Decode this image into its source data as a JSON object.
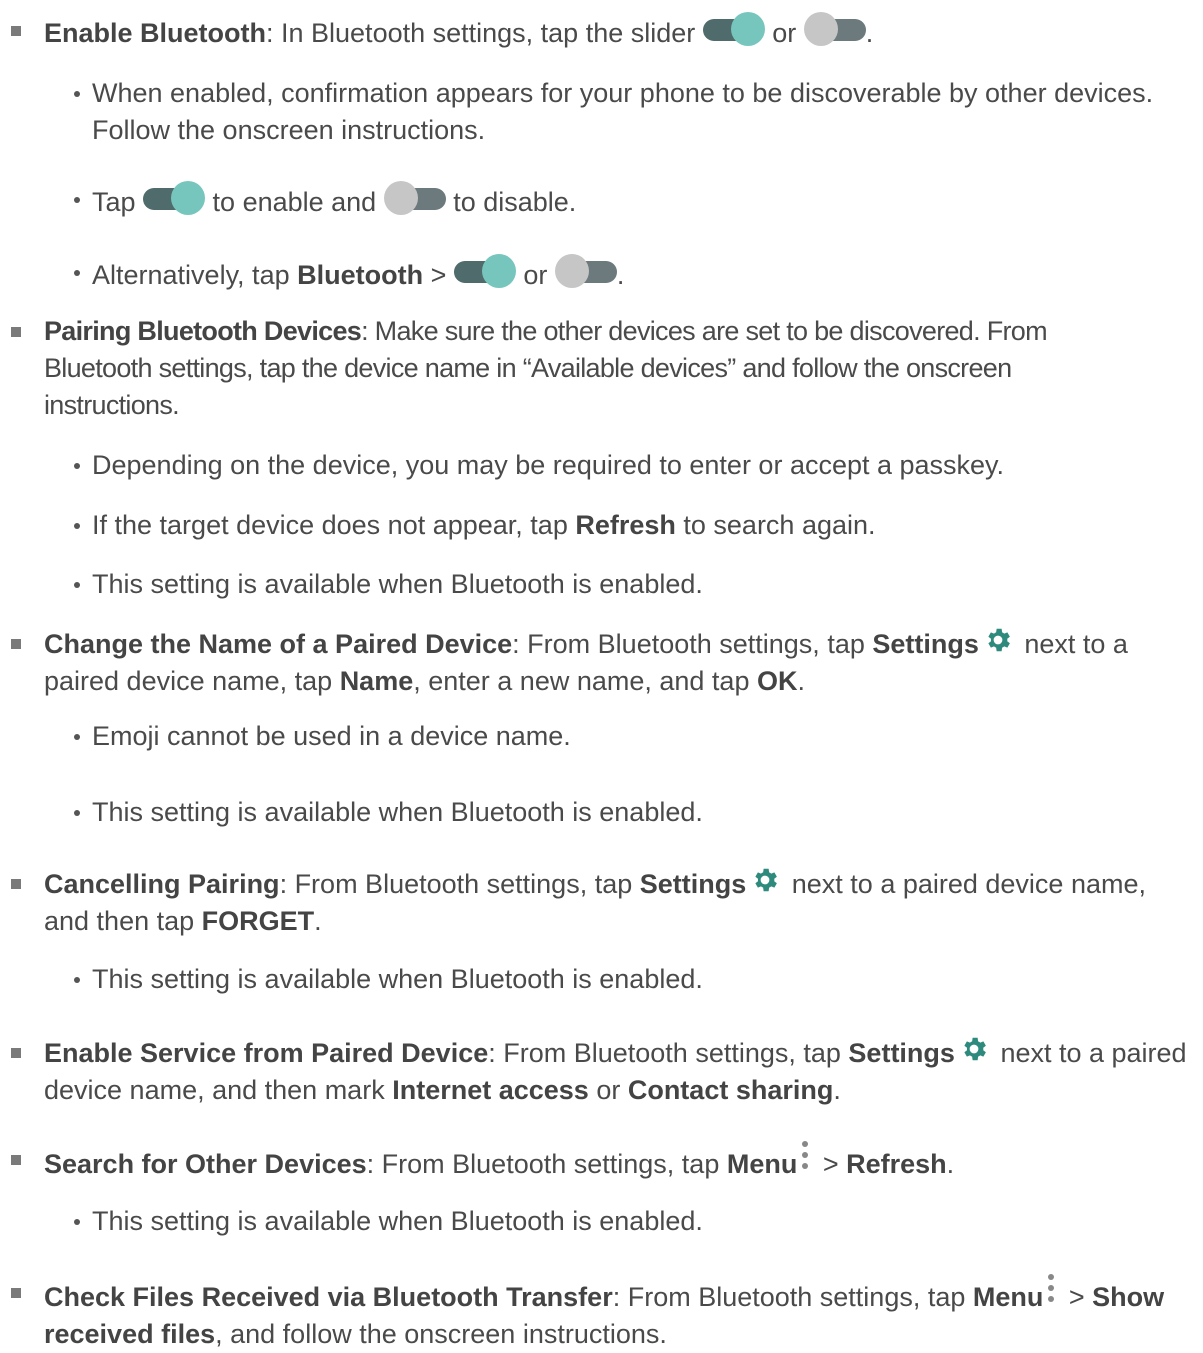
{
  "items": {
    "enable": {
      "title": "Enable Bluetooth",
      "t1": ": In Bluetooth settings, tap the slider ",
      "t2": " or ",
      "t3": ".",
      "sub1": "When enabled, confirmation appears for your phone to be discoverable by other devices. Follow the onscreen instructions.",
      "sub2a": "Tap ",
      "sub2b": " to enable and ",
      "sub2c": " to disable.",
      "sub3a": "Alternatively, tap ",
      "sub3b": "Bluetooth",
      "sub3c": " > ",
      "sub3d": " or ",
      "sub3e": "."
    },
    "pairing": {
      "title": "Pairing Bluetooth Devices",
      "text": ": Make sure the other devices are set to be discovered. From Bluetooth settings, tap the device name in “Available devices” and follow the onscreen instructions.",
      "sub1": "Depending on the device, you may be required to enter or accept a passkey.",
      "sub2a": "If the target device does not appear, tap ",
      "sub2b": "Refresh",
      "sub2c": " to search again.",
      "sub3": "This setting is available when Bluetooth is enabled."
    },
    "rename": {
      "title": "Change the Name of a Paired Device",
      "t1": ": From Bluetooth settings, tap ",
      "t2": "Settings",
      "t3": " next to a paired device name, tap ",
      "t4": "Name",
      "t5": ", enter a new name, and tap ",
      "t6": "OK",
      "t7": ".",
      "sub1": "Emoji cannot be used in a device name.",
      "sub2": "This setting is available when Bluetooth is enabled."
    },
    "cancel": {
      "title": "Cancelling Pairing",
      "t1": ": From Bluetooth settings, tap ",
      "t2": "Settings",
      "t3": " next to a paired device name, and then tap ",
      "t4": "FORGET",
      "t5": ".",
      "sub1": "This setting is available when Bluetooth is enabled."
    },
    "service": {
      "title": "Enable Service from Paired Device",
      "t1": ": From Bluetooth settings, tap ",
      "t2": "Settings",
      "t3": " next to a paired device name, and then mark ",
      "t4": "Internet access",
      "t5": " or ",
      "t6": "Contact sharing",
      "t7": "."
    },
    "search": {
      "title": "Search for Other Devices",
      "t1": ": From Bluetooth settings, tap ",
      "t2": "Menu",
      "t3": " > ",
      "t4": "Refresh",
      "t5": ".",
      "sub1": "This setting is available when Bluetooth is enabled."
    },
    "files": {
      "title": "Check Files Received via Bluetooth Transfer",
      "t1": ": From Bluetooth settings, tap ",
      "t2": "Menu",
      "t3": " > ",
      "t4": "Show received files",
      "t5": ", and follow the onscreen instructions."
    }
  },
  "icons": {
    "toggle_on": "toggle-on-icon",
    "toggle_off": "toggle-off-icon",
    "gear": "gear-icon",
    "menu": "menu-dots-icon"
  },
  "colors": {
    "toggle_on_track": "#4f6b6b",
    "toggle_on_knob": "#76c6bd",
    "toggle_off_track": "#6c7a7d",
    "toggle_off_knob": "#c6c6c6",
    "gear": "#2f8a7e"
  }
}
